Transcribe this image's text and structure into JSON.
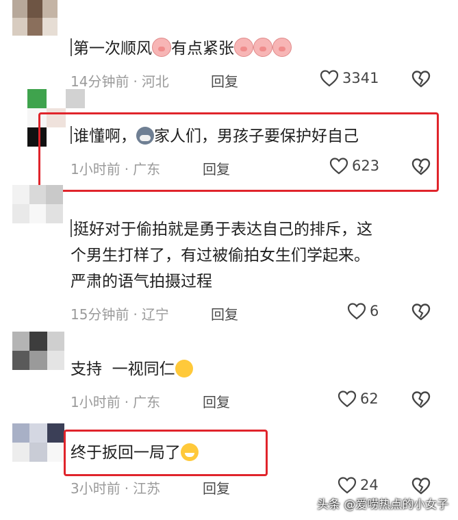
{
  "comments": [
    {
      "text_parts": [
        "第一次顺风",
        "有点紧张"
      ],
      "time": "14分钟前",
      "location": "河北",
      "reply_label": "回复",
      "likes": "3341"
    },
    {
      "text_parts": [
        "谁懂啊，",
        "家人们，男孩子要保护好自己"
      ],
      "time": "1小时前",
      "location": "广东",
      "reply_label": "回复",
      "likes": "623"
    },
    {
      "text_lines": [
        "挺好对于偷拍就是勇于表达自己的排斥，这",
        "个男生打样了，有过被偷拍女生们学起来。",
        "严肃的语气拍摄过程"
      ],
      "time": "15分钟前",
      "location": "辽宁",
      "reply_label": "回复",
      "likes": "6"
    },
    {
      "text_parts": [
        "支持  一视同仁"
      ],
      "time": "1小时前",
      "location": "广东",
      "reply_label": "回复",
      "likes": "62"
    },
    {
      "text_parts": [
        "终于扳回一局了"
      ],
      "time": "3小时前",
      "location": "江苏",
      "reply_label": "回复",
      "likes": "24"
    }
  ],
  "separator": "·",
  "watermark": "头条 @爱唠热点的小女子",
  "colors": {
    "highlight_box": "#e0242b",
    "meta_text": "#9a9a9a"
  },
  "icons": {
    "like": "heart-outline-icon",
    "dislike": "broken-heart-icon"
  }
}
